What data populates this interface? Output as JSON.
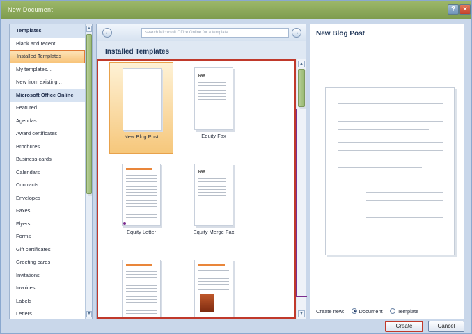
{
  "window": {
    "title": "New Document",
    "help_icon": "?",
    "close_icon": "×"
  },
  "left_panel": {
    "items": [
      {
        "label": "Templates",
        "kind": "header"
      },
      {
        "label": "Blank and recent",
        "kind": "item"
      },
      {
        "label": "Installed Templates",
        "kind": "selected"
      },
      {
        "label": "My templates...",
        "kind": "item"
      },
      {
        "label": "New from existing...",
        "kind": "item"
      },
      {
        "label": "Microsoft Office Online",
        "kind": "header"
      },
      {
        "label": "Featured",
        "kind": "item"
      },
      {
        "label": "Agendas",
        "kind": "item"
      },
      {
        "label": "Award certificates",
        "kind": "item"
      },
      {
        "label": "Brochures",
        "kind": "item"
      },
      {
        "label": "Business cards",
        "kind": "item"
      },
      {
        "label": "Calendars",
        "kind": "item"
      },
      {
        "label": "Contracts",
        "kind": "item"
      },
      {
        "label": "Envelopes",
        "kind": "item"
      },
      {
        "label": "Faxes",
        "kind": "item"
      },
      {
        "label": "Flyers",
        "kind": "item"
      },
      {
        "label": "Forms",
        "kind": "item"
      },
      {
        "label": "Gift certificates",
        "kind": "item"
      },
      {
        "label": "Greeting cards",
        "kind": "item"
      },
      {
        "label": "Invitations",
        "kind": "item"
      },
      {
        "label": "Invoices",
        "kind": "item"
      },
      {
        "label": "Labels",
        "kind": "item"
      },
      {
        "label": "Letters",
        "kind": "item"
      }
    ]
  },
  "middle_panel": {
    "back_icon": "←",
    "forward_icon": "→",
    "address": "search Microsoft Office Online for a template",
    "section_title": "Installed Templates",
    "templates": [
      {
        "label": "New Blog Post",
        "style": "blank",
        "selected": true
      },
      {
        "label": "Equity Fax",
        "style": "fax",
        "selected": false
      },
      {
        "label": "Equity Letter",
        "style": "letter",
        "selected": false
      },
      {
        "label": "Equity Merge Fax",
        "style": "fax",
        "selected": false
      },
      {
        "label": "",
        "style": "letter",
        "selected": false
      },
      {
        "label": "",
        "style": "flyer",
        "selected": false
      }
    ],
    "fax_heading": "FAX"
  },
  "preview_panel": {
    "title": "New Blog Post",
    "create_new_label": "Create new:",
    "option_document": "Document",
    "option_template": "Template",
    "selected_option": "Document"
  },
  "buttons": {
    "create": "Create",
    "cancel": "Cancel"
  },
  "colors": {
    "title_bar": "#8aa85a",
    "selection_orange": "#f8c47a",
    "highlight_red": "#c0392b",
    "accent_purple": "#7b2d8e"
  }
}
